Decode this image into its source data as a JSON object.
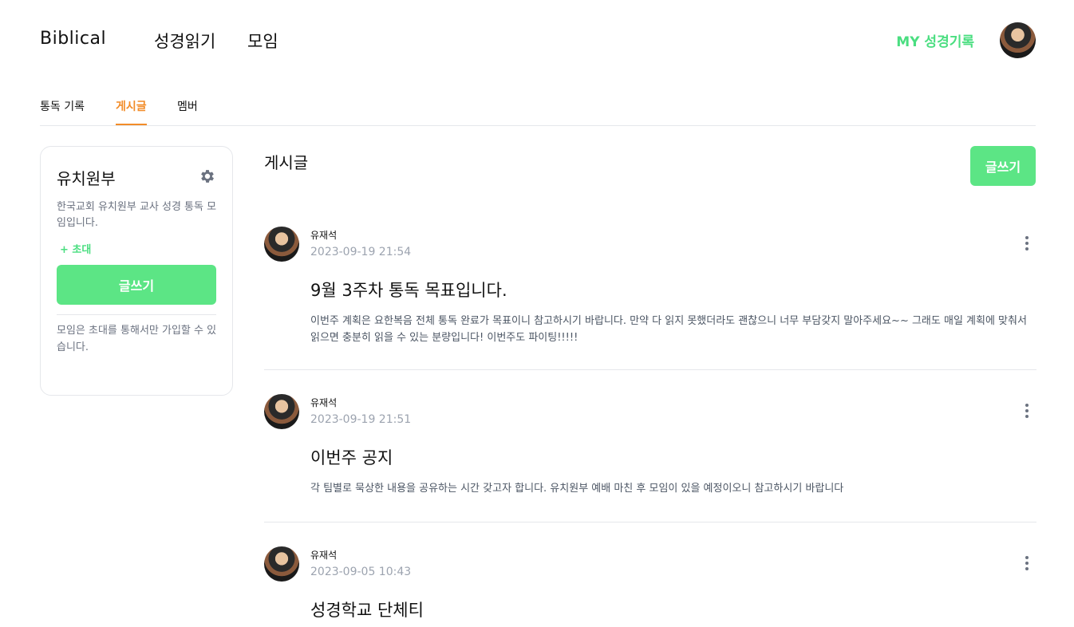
{
  "header": {
    "logo": "Biblical",
    "nav": [
      "성경읽기",
      "모임"
    ],
    "my_record": "MY 성경기록"
  },
  "tabs": [
    {
      "label": "통독 기록",
      "active": false
    },
    {
      "label": "게시글",
      "active": true
    },
    {
      "label": "멤버",
      "active": false
    }
  ],
  "group": {
    "name": "유치원부",
    "description": "한국교회 유치원부 교사 성경 통독 모임입니다.",
    "invite_label": "+ 초대",
    "write_label": "글쓰기",
    "note": "모임은 초대를 통해서만 가입할 수 있습니다."
  },
  "main": {
    "title": "게시글",
    "write_label": "글쓰기"
  },
  "posts": [
    {
      "author": "유재석",
      "date": "2023-09-19 21:54",
      "title": "9월 3주차 통독 목표입니다.",
      "body": "이번주 계획은 요한복음 전체 통독 완료가 목표이니 참고하시기 바랍니다. 만약 다 읽지 못했더라도 괜찮으니 너무 부담갖지 말아주세요~~ 그래도 매일 계획에 맞춰서 읽으면 충분히 읽을 수 있는 분량입니다! 이번주도 파이팅!!!!!"
    },
    {
      "author": "유재석",
      "date": "2023-09-19 21:51",
      "title": "이번주 공지",
      "body": "각 팀별로 묵상한 내용을 공유하는 시간 갖고자 합니다. 유치원부 예배 마친 후 모임이 있을 예정이오니 참고하시기 바랍니다"
    },
    {
      "author": "유재석",
      "date": "2023-09-05 10:43",
      "title": "성경학교 단체티",
      "body": ""
    }
  ],
  "colors": {
    "accent_green": "#5ce585",
    "accent_orange": "#f28c28"
  }
}
